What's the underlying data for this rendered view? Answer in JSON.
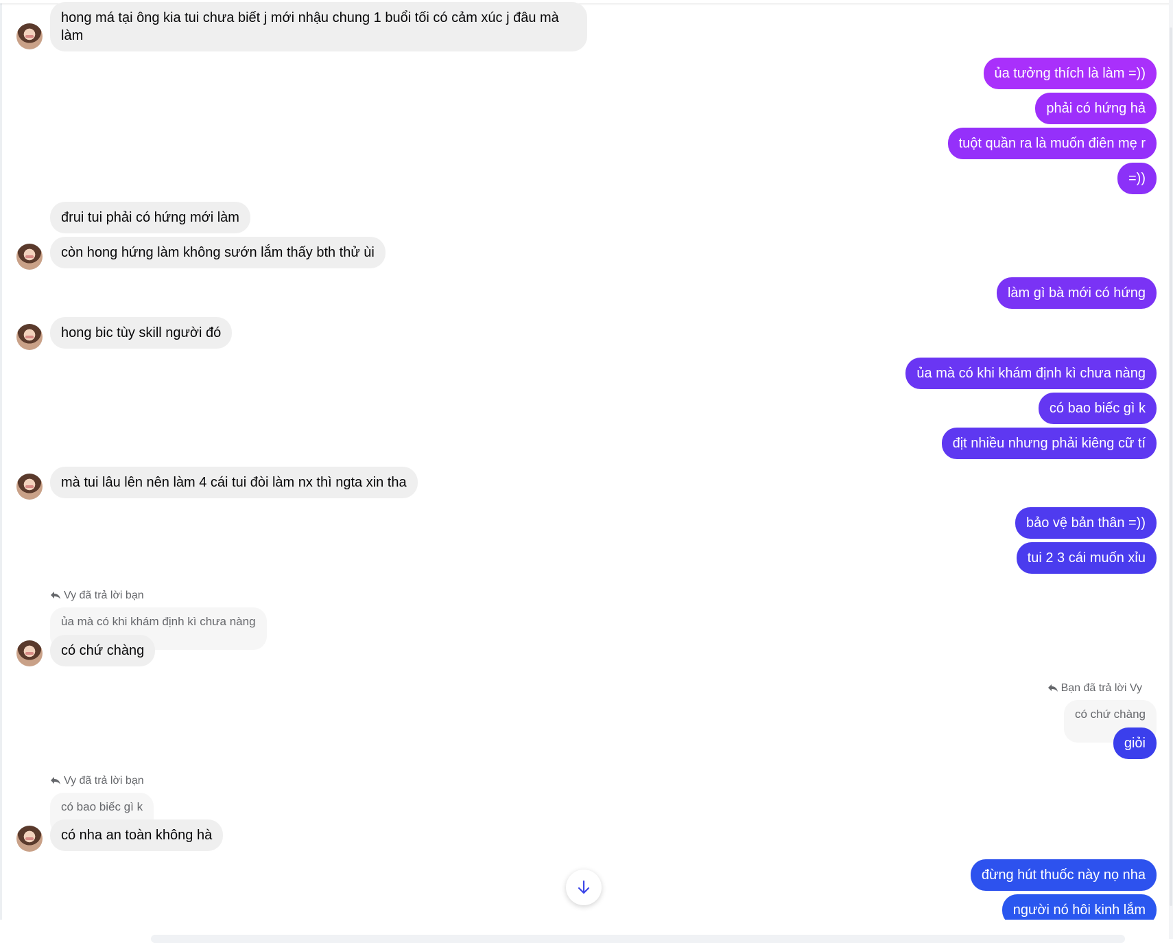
{
  "messages": {
    "in_1": "hong má tại ông kia tui chưa biết j mới nhậu chung 1 buổi tối có cảm xúc j đâu mà làm",
    "out_1": "ủa tưởng thích là làm =))",
    "out_2": "phải có hứng hả",
    "out_3": "tuột quần ra là muốn điên mẹ r",
    "out_4": "=))",
    "in_2": "đrui tui phải có hứng mới làm",
    "in_3": "còn hong hứng làm không sướn lắm thấy bth thử ùi",
    "out_5": "làm gì bà mới có hứng",
    "in_4": "hong bic tùy skill người đó",
    "out_6": "ủa mà có khi khám định kì chưa nàng",
    "out_7": "có bao biếc gì k",
    "out_8": "địt nhiều nhưng phải kiêng cữ tí",
    "in_5": "mà tui lâu lên nên làm 4 cái tui đòi làm nx thì ngta xin tha",
    "out_9": "bảo vệ bản thân =))",
    "out_10": "tui 2 3 cái muốn xỉu",
    "reply_1_note": "Vy đã trả lời bạn",
    "reply_1_quote": "ủa mà có khi khám định kì chưa nàng",
    "in_6": "có chứ chàng",
    "reply_2_note": "Bạn đã trả lời Vy",
    "reply_2_quote": "có chứ chàng",
    "out_11": "giỏi",
    "reply_3_note": "Vy đã trả lời bạn",
    "reply_3_quote": "có bao biếc gì k",
    "in_7": "có nha an toàn không hà",
    "out_12": "đừng hút thuốc này nọ nha",
    "out_13": "người nó hôi kinh lắm"
  },
  "colors": {
    "incoming_bg": "#efefef",
    "outgoing_gradient_top": "#a033ff",
    "outgoing_gradient_bottom": "#0866ff"
  },
  "icons": {
    "reply": "reply-arrow-icon",
    "scroll_down": "arrow-down-icon"
  }
}
